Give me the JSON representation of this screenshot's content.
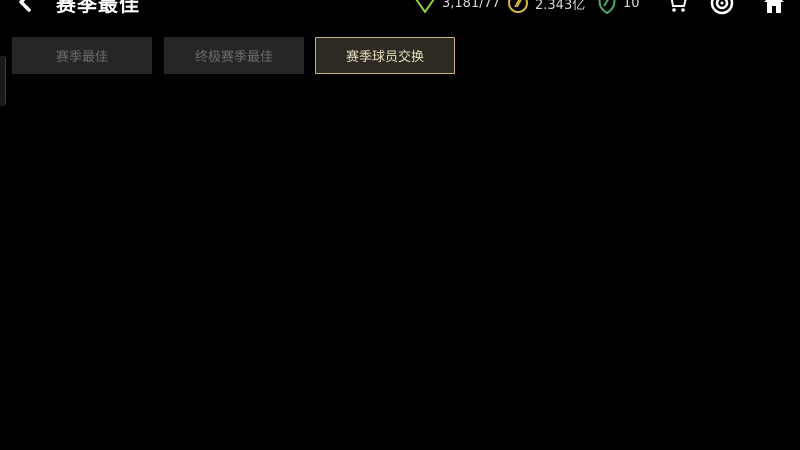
{
  "header": {
    "title": "赛季最佳",
    "stats": [
      {
        "icon": "green-diamond-icon",
        "value": "3,181/77"
      },
      {
        "icon": "gold-coin-icon",
        "value": "2.343亿"
      },
      {
        "icon": "green-shield-icon",
        "value": "10"
      }
    ]
  },
  "icons": {
    "back": "back-arrow-icon",
    "cart": "cart-icon",
    "target": "target-icon",
    "home": "home-icon"
  },
  "tabs": [
    {
      "label": "赛季最佳",
      "active": false
    },
    {
      "label": "终极赛季最佳",
      "active": false
    },
    {
      "label": "赛季球员交换",
      "active": true
    }
  ],
  "colors": {
    "background": "#000000",
    "tab_inactive_bg": "#262626",
    "tab_inactive_text": "#6c6c6c",
    "tab_active_border": "#c8b484",
    "tab_active_text": "#e8dcc0",
    "diamond": "#8ccf3a",
    "coin": "#d7b64a",
    "shield": "#4faa6a"
  }
}
